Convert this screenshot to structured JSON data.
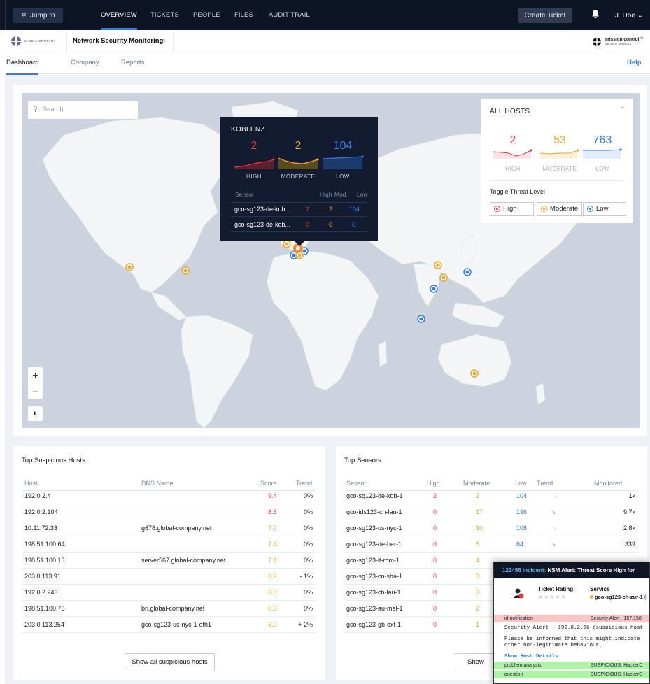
{
  "topnav": {
    "jump_to": "Jump to",
    "links": [
      "OVERVIEW",
      "TICKETS",
      "PEOPLE",
      "FILES",
      "AUDIT TRAIL"
    ],
    "create_ticket": "Create Ticket",
    "user": "J. Doe ⌄"
  },
  "tabbar": {
    "company_logo_text": "GLOBAL COMPANY",
    "app_tab": "Network Security Monitoring",
    "close": "×",
    "brand_name": "mission control™",
    "brand_sub": "security services"
  },
  "subnav": {
    "tabs": [
      "Dashboard",
      "Company",
      "Reports"
    ],
    "help": "Help"
  },
  "map": {
    "search_placeholder": "Search",
    "zoom_in": "+",
    "zoom_out": "−"
  },
  "koblenz": {
    "title": "KOBLENZ",
    "high": "2",
    "moderate": "2",
    "low": "104",
    "high_label": "HIGH",
    "moderate_label": "MODERATE",
    "low_label": "LOW",
    "columns": [
      "Sensor",
      "High",
      "Mod.",
      "Low"
    ],
    "rows": [
      {
        "sensor": "gco-sg123-de-kob...",
        "high": "2",
        "mod": "2",
        "low": "104"
      },
      {
        "sensor": "gco-sg123-de-kob...",
        "high": "0",
        "mod": "0",
        "low": "0"
      }
    ]
  },
  "all_hosts": {
    "title": "ALL HOSTS",
    "high": "2",
    "moderate": "53",
    "low": "763",
    "high_label": "HIGH",
    "moderate_label": "MODERATE",
    "low_label": "LOW",
    "toggle_label": "Toggle Threat Level",
    "toggles": [
      "High",
      "Moderate",
      "Low"
    ]
  },
  "suspicious_hosts": {
    "title": "Top Suspicious Hosts",
    "columns": [
      "Host",
      "DNS Name",
      "Score",
      "Trend"
    ],
    "rows": [
      {
        "host": "192.0.2.4",
        "dns": "",
        "score": "9.4",
        "trend": "0%"
      },
      {
        "host": "192.0.2.104",
        "dns": "",
        "score": "8.8",
        "trend": "0%"
      },
      {
        "host": "10.11.72.33",
        "dns": "g678.global-company.net",
        "score": "7.7",
        "trend": "0%"
      },
      {
        "host": "198.51.100.64",
        "dns": "",
        "score": "7.4",
        "trend": "0%"
      },
      {
        "host": "198.51.100.13",
        "dns": "server567.global-company.net",
        "score": "7.1",
        "trend": "0%"
      },
      {
        "host": "203.0.113.91",
        "dns": "",
        "score": "6.9",
        "trend": "- 1%"
      },
      {
        "host": "192.0.2.243",
        "dns": "",
        "score": "6.8",
        "trend": "0%"
      },
      {
        "host": "198.51.100.78",
        "dns": "bn.global-company.net",
        "score": "6.3",
        "trend": "0%"
      },
      {
        "host": "203.0.113.254",
        "dns": "gco-sg123-us-nyc-1-eth1",
        "score": "6.0",
        "trend": "+ 2%"
      }
    ],
    "show_all": "Show all suspicious hosts"
  },
  "sensors": {
    "title": "Top Sensors",
    "columns": [
      "Sensor",
      "High",
      "Moderate",
      "Low",
      "Trend",
      "Monitored"
    ],
    "rows": [
      {
        "sensor": "gco-sg123-de-kob-1",
        "high": "2",
        "mod": "2",
        "low": "104",
        "trend": "→",
        "monitored": "1k"
      },
      {
        "sensor": "gco-ids123-ch-lau-1",
        "high": "0",
        "mod": "17",
        "low": "196",
        "trend": "↘",
        "monitored": "9.7k"
      },
      {
        "sensor": "gco-sg123-us-nyc-1",
        "high": "0",
        "mod": "10",
        "low": "106",
        "trend": "→",
        "monitored": "2.8k"
      },
      {
        "sensor": "gco-sg123-de-ber-1",
        "high": "0",
        "mod": "5",
        "low": "64",
        "trend": "↘",
        "monitored": "339"
      },
      {
        "sensor": "gco-sg123-it-rom-1",
        "high": "0",
        "mod": "4",
        "low": "",
        "trend": "",
        "monitored": ""
      },
      {
        "sensor": "gco-sg123-cn-sha-1",
        "high": "0",
        "mod": "3",
        "low": "",
        "trend": "",
        "monitored": ""
      },
      {
        "sensor": "gco-sg123-ch-lau-1",
        "high": "0",
        "mod": "3",
        "low": "",
        "trend": "",
        "monitored": ""
      },
      {
        "sensor": "gco-sg123-au-mel-1",
        "high": "0",
        "mod": "2",
        "low": "",
        "trend": "",
        "monitored": ""
      },
      {
        "sensor": "gco-sg123-gb-oxf-1",
        "high": "0",
        "mod": "1",
        "low": "",
        "trend": "",
        "monitored": ""
      }
    ],
    "show_all": "Show"
  },
  "incident": {
    "id": "123456 Incident:",
    "title": " NSM Alert: Threat Score High for",
    "rating_label": "Ticket Rating",
    "stars": "★★★★★",
    "service_label": "Service",
    "service_value": "gco-sg123-ch-zur-1",
    "service_suffix": " (l",
    "notif_left": "id notification",
    "notif_right": "Security Alert - 157.150",
    "mono_line1": "Security Alert - 192.0.2.66 (suspicious_host",
    "mono_line2": "Please be informed that this might indicate",
    "mono_line3": "other non-legitimate behaviour.",
    "show_details": "Show Host Details",
    "row1_left": "problem analysis",
    "row1_right": "SUSPICIOUS: HackerD",
    "row2_left": "question",
    "row2_right": "SUSPICIOUS: HackerD"
  },
  "colors": {
    "high": "#f5333f",
    "moderate": "#f5a623",
    "low": "#2f7dea",
    "nav": "#0d1424"
  }
}
